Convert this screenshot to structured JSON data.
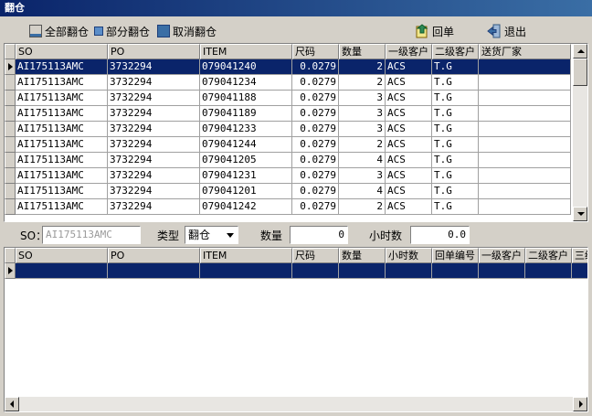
{
  "window": {
    "title": "翻仓"
  },
  "toolbar": {
    "all_label": "全部翻仓",
    "partial_label": "部分翻仓",
    "cancel_label": "取消翻仓",
    "return_label": "回单",
    "exit_label": "退出"
  },
  "top_grid": {
    "columns": [
      "SO",
      "PO",
      "ITEM",
      "尺码",
      "数量",
      "一级客户",
      "二级客户",
      "送货厂家"
    ],
    "rows": [
      [
        "AI175113AMC",
        "3732294",
        "079041240",
        "0.0279",
        "2",
        "ACS",
        "T.G",
        ""
      ],
      [
        "AI175113AMC",
        "3732294",
        "079041234",
        "0.0279",
        "2",
        "ACS",
        "T.G",
        ""
      ],
      [
        "AI175113AMC",
        "3732294",
        "079041188",
        "0.0279",
        "3",
        "ACS",
        "T.G",
        ""
      ],
      [
        "AI175113AMC",
        "3732294",
        "079041189",
        "0.0279",
        "3",
        "ACS",
        "T.G",
        ""
      ],
      [
        "AI175113AMC",
        "3732294",
        "079041233",
        "0.0279",
        "3",
        "ACS",
        "T.G",
        ""
      ],
      [
        "AI175113AMC",
        "3732294",
        "079041244",
        "0.0279",
        "2",
        "ACS",
        "T.G",
        ""
      ],
      [
        "AI175113AMC",
        "3732294",
        "079041205",
        "0.0279",
        "4",
        "ACS",
        "T.G",
        ""
      ],
      [
        "AI175113AMC",
        "3732294",
        "079041231",
        "0.0279",
        "3",
        "ACS",
        "T.G",
        ""
      ],
      [
        "AI175113AMC",
        "3732294",
        "079041201",
        "0.0279",
        "4",
        "ACS",
        "T.G",
        ""
      ],
      [
        "AI175113AMC",
        "3732294",
        "079041242",
        "0.0279",
        "2",
        "ACS",
        "T.G",
        ""
      ]
    ],
    "selected_row": 0
  },
  "filter": {
    "so_label": "SO：",
    "so_placeholder": "AI175113AMC",
    "type_label": "类型",
    "type_value": "翻仓",
    "qty_label": "数量",
    "qty_value": "0",
    "hours_label": "小时数",
    "hours_value": "0.0"
  },
  "bottom_grid": {
    "columns": [
      "SO",
      "PO",
      "ITEM",
      "尺码",
      "数量",
      "小时数",
      "回单编号",
      "一级客户",
      "二级客户",
      "三级客户"
    ]
  },
  "colors": {
    "selection": "#0a246a",
    "title_bar": "#0a246a",
    "face": "#d4d0c8"
  },
  "icons": {
    "all": "select-all-icon",
    "partial": "partial-select-icon",
    "cancel": "cancel-select-icon",
    "return": "return-receipt-icon",
    "exit": "exit-door-icon"
  }
}
